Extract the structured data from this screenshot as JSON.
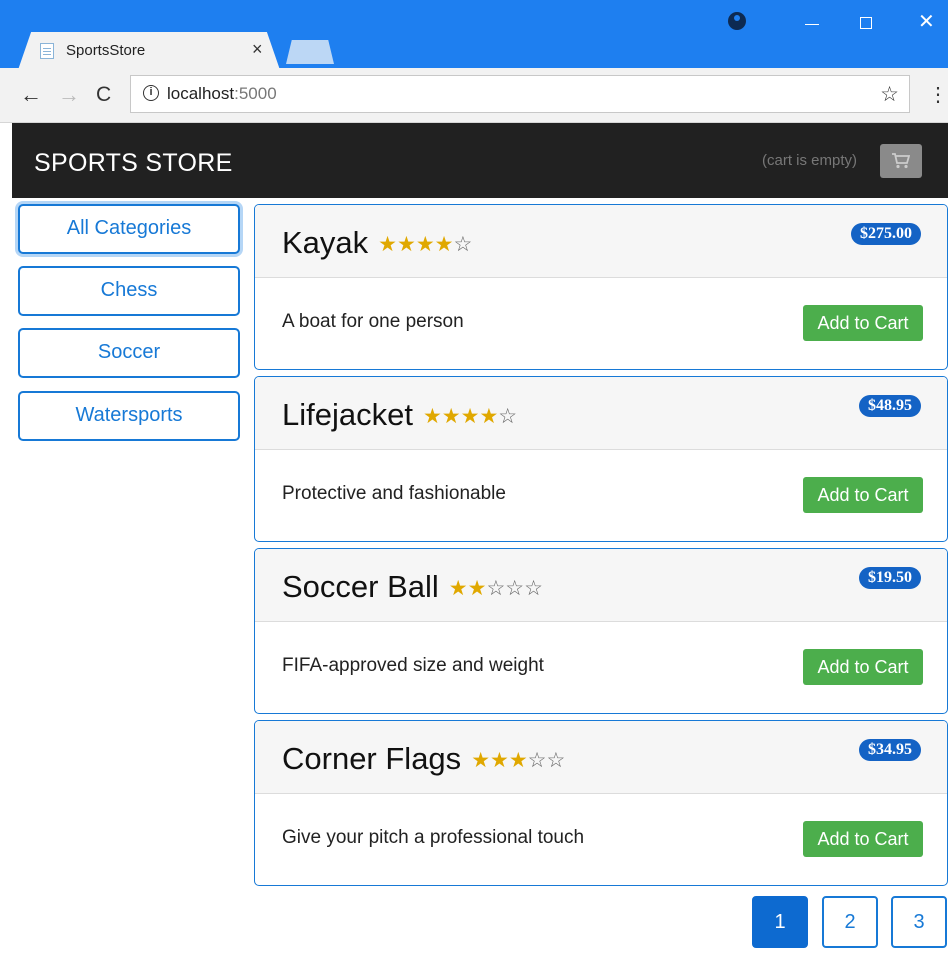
{
  "browser": {
    "tab_title": "SportsStore",
    "tab_close": "×",
    "url_host": "localhost",
    "url_port": ":5000",
    "back": "←",
    "forward": "→",
    "reload": "C",
    "star": "☆",
    "menu": "⋮",
    "close_window": "✕"
  },
  "navbar": {
    "brand": "SPORTS STORE",
    "cart_status": "(cart is empty)"
  },
  "categories": [
    {
      "label": "All Categories",
      "active": true
    },
    {
      "label": "Chess"
    },
    {
      "label": "Soccer"
    },
    {
      "label": "Watersports"
    }
  ],
  "products": [
    {
      "name": "Kayak",
      "stars_on": "★★★★",
      "stars_off": "☆",
      "rating": 4,
      "price": "$275.00",
      "description": "A boat for one person",
      "button": "Add to Cart"
    },
    {
      "name": "Lifejacket",
      "stars_on": "★★★★",
      "stars_off": "☆",
      "rating": 4,
      "price": "$48.95",
      "description": "Protective and fashionable",
      "button": "Add to Cart"
    },
    {
      "name": "Soccer Ball",
      "stars_on": "★★",
      "stars_off": "☆☆☆",
      "rating": 2,
      "price": "$19.50",
      "description": "FIFA-approved size and weight",
      "button": "Add to Cart"
    },
    {
      "name": "Corner Flags",
      "stars_on": "★★★",
      "stars_off": "☆☆",
      "rating": 3,
      "price": "$34.95",
      "description": "Give your pitch a professional touch",
      "button": "Add to Cart"
    }
  ],
  "pagination": {
    "pages": [
      "1",
      "2",
      "3"
    ],
    "current": "1"
  },
  "colors": {
    "titlebar": "#1e7ff0",
    "navbar": "#212121",
    "accent": "#1779d6",
    "price_badge": "#1463c5",
    "add_button": "#4cae4c",
    "star": "#e0a800"
  }
}
